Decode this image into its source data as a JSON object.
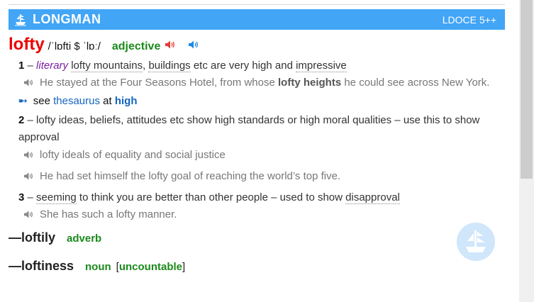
{
  "header": {
    "brand": "LONGMAN",
    "edition": "LDOCE 5++",
    "logo_icon": "ship-icon",
    "bg_color": "#42a5f5"
  },
  "entry": {
    "headword": "lofty",
    "pronunciation": "/ˈlɒfti $ ˈlɒː/",
    "pos": "adjective",
    "audio_icons": [
      "speaker-red-icon",
      "speaker-blue-icon"
    ],
    "senses": [
      {
        "num": "1",
        "register": "literary",
        "def_parts": [
          "lofty mountains",
          ", ",
          "buildings",
          " etc are very high and ",
          "impressive"
        ],
        "examples": [
          {
            "pre": "He stayed at the Four Seasons Hotel, from whose ",
            "colloc": "lofty heights",
            "post": " he could see across New York."
          }
        ],
        "xref": {
          "arrow": "➸",
          "see": "see",
          "thesaurus": "thesaurus",
          "at": "at",
          "target": "high"
        }
      },
      {
        "num": "2",
        "def": "lofty ideas, beliefs, attitudes etc show high standards or high moral qualities – use this to show approval",
        "examples": [
          {
            "text": "lofty ideals of equality and social justice"
          },
          {
            "text": "He had set himself the lofty goal of reaching the world’s top five."
          }
        ]
      },
      {
        "num": "3",
        "def_parts": [
          "seeming",
          " to think you are better than other people – used to show ",
          "disapproval"
        ],
        "examples": [
          {
            "text": "She has such a lofty manner."
          }
        ]
      }
    ],
    "runons": [
      {
        "word": "—loftily",
        "pos": "adverb"
      },
      {
        "word": "—loftiness",
        "pos": "noun",
        "grammar": "uncountable"
      }
    ]
  },
  "colors": {
    "headword": "#ee0000",
    "pos": "#1a8a1a",
    "register": "#7b1fa2",
    "link": "#1565c0"
  }
}
